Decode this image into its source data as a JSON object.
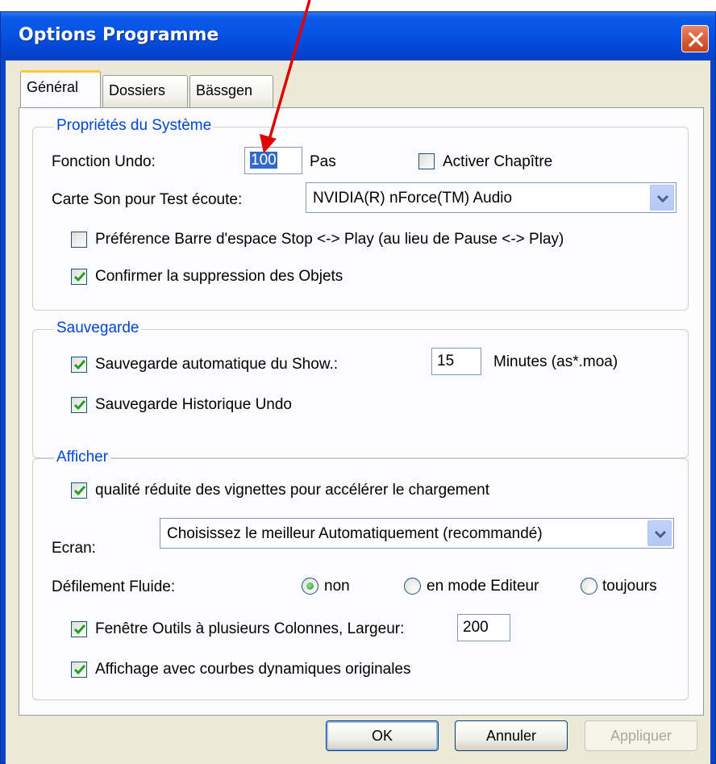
{
  "window": {
    "title": "Options Programme",
    "close_icon": "close-icon"
  },
  "tabs": [
    {
      "label": "Général",
      "active": true
    },
    {
      "label": "Dossiers",
      "active": false
    },
    {
      "label": "Bässgen",
      "active": false
    }
  ],
  "systeme": {
    "title": "Propriétés du Système",
    "undo_label": "Fonction Undo:",
    "undo_value": "100",
    "undo_unit": "Pas",
    "chapitre_label": "Activer Chapître",
    "chapitre_checked": false,
    "carte_label": "Carte Son pour Test écoute:",
    "carte_value": "NVIDIA(R) nForce(TM) Audio",
    "barre_label": "Préférence Barre d'espace Stop <-> Play (au lieu de Pause <-> Play)",
    "barre_checked": false,
    "confirmer_label": "Confirmer la suppression des Objets",
    "confirmer_checked": true
  },
  "sauvegarde": {
    "title": "Sauvegarde",
    "auto_label": "Sauvegarde automatique du Show.:",
    "auto_checked": true,
    "auto_value": "15",
    "auto_unit": "Minutes (as*.moa)",
    "historique_label": "Sauvegarde Historique Undo",
    "historique_checked": true
  },
  "afficher": {
    "title": "Afficher",
    "qualite_label": "qualité réduite des vignettes pour accélérer le chargement",
    "qualite_checked": true,
    "ecran_label": "Ecran:",
    "ecran_value": "Choisissez le meilleur Automatiquement (recommandé)",
    "defilement_label": "Défilement Fluide:",
    "defilement_options": [
      "non",
      "en mode Editeur",
      "toujours"
    ],
    "defilement_selected": "non",
    "outils_label": "Fenêtre Outils à plusieurs Colonnes, Largeur:",
    "outils_checked": true,
    "outils_value": "200",
    "courbes_label": "Affichage avec courbes dynamiques originales",
    "courbes_checked": true
  },
  "buttons": {
    "ok": "OK",
    "annuler": "Annuler",
    "appliquer": "Appliquer"
  },
  "annotation": {
    "color": "#e00000"
  }
}
